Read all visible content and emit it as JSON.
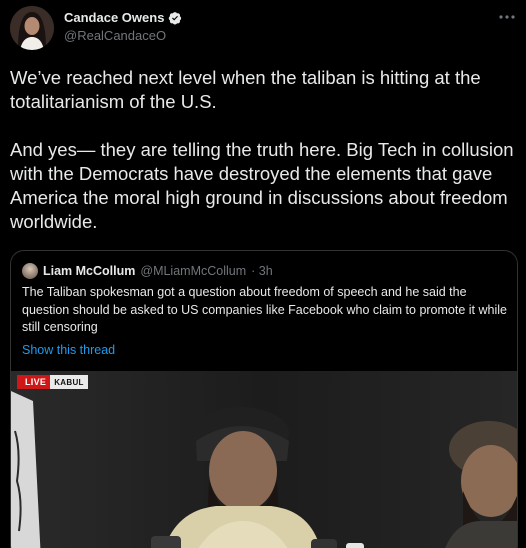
{
  "author": {
    "display_name": "Candace Owens",
    "handle": "@RealCandaceO",
    "verified": true
  },
  "tweet": {
    "paragraph_1": "We’ve reached next level when the taliban is hitting at the totalitarianism of the U.S.",
    "paragraph_2": "And yes— they are telling the truth here. Big Tech in collusion with the Democrats have destroyed the elements that gave America the moral high ground in discussions about freedom worldwide."
  },
  "quoted_tweet": {
    "display_name": "Liam McCollum",
    "handle": "@MLiamMcCollum",
    "time": "· 3h",
    "text": "The Taliban spokesman got a question about freedom of speech and he said the question should be asked to US companies like Facebook who claim to promote it while still censoring",
    "show_thread": "Show this thread",
    "media": {
      "live_label": "LIVE",
      "location_label": "KABUL"
    }
  },
  "icons": {
    "more": "more-horizontal-icon",
    "verified": "verified-badge-icon"
  },
  "colors": {
    "background": "#000000",
    "text": "#e7e9ea",
    "secondary": "#71767b",
    "link": "#1d9bf0",
    "verified": "#e7e9ea",
    "live": "#d01717"
  }
}
